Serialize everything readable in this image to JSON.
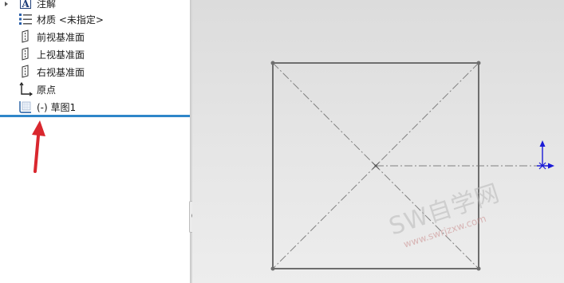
{
  "tree": {
    "items": [
      {
        "label": "注解",
        "icon": "annotation-icon"
      },
      {
        "label": "材质 <未指定>",
        "icon": "material-icon"
      },
      {
        "label": "前视基准面",
        "icon": "plane-icon"
      },
      {
        "label": "上视基准面",
        "icon": "plane-icon"
      },
      {
        "label": "右视基准面",
        "icon": "plane-icon"
      },
      {
        "label": "原点",
        "icon": "origin-icon"
      },
      {
        "label": "(-) 草图1",
        "icon": "sketch-icon"
      }
    ]
  },
  "watermark": {
    "title": "SW自学网",
    "url": "www.swrjzxw.com"
  },
  "colors": {
    "selection": "#2f86c9",
    "arrow": "#d9272e",
    "sketch_line": "#707070",
    "axis": "#1a1ad6"
  }
}
